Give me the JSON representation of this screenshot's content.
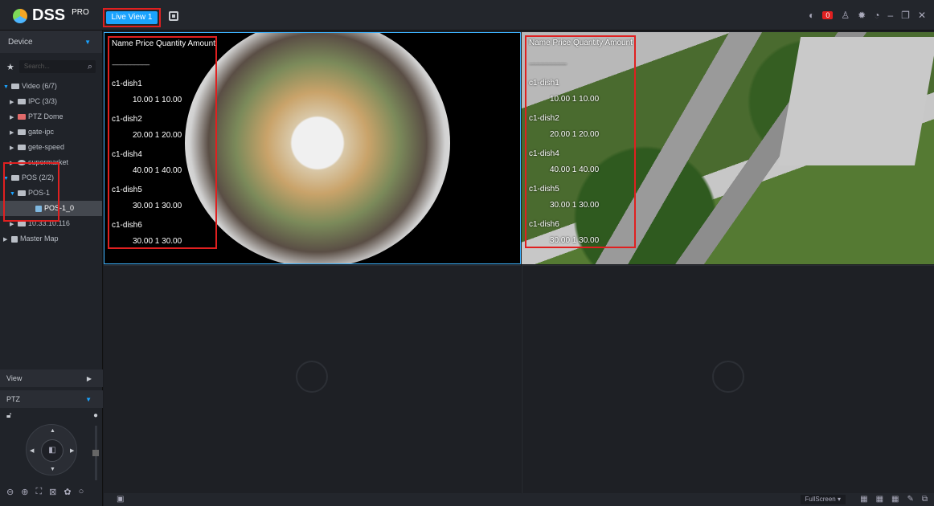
{
  "app": {
    "brand": "DSS",
    "edition": "PRO",
    "accent": "#1aa3ff",
    "alert_color": "#e02020"
  },
  "tabs": [
    {
      "label": "Live View 1"
    }
  ],
  "top_right": {
    "alarm_count": "0",
    "icons": [
      "speaker-icon",
      "user-icon",
      "gear-icon",
      "dashboard-icon",
      "minimize-icon",
      "restore-icon",
      "close-icon"
    ]
  },
  "sidebar": {
    "device_label": "Device",
    "search_placeholder": "Search...",
    "tree": [
      {
        "label": "Video (6/7)",
        "level": 0,
        "icon": "camera-group-icon"
      },
      {
        "label": "IPC (3/3)",
        "level": 1,
        "icon": "ipc-icon"
      },
      {
        "label": "PTZ Dome",
        "level": 1,
        "icon": "ptz-icon"
      },
      {
        "label": "gate-ipc",
        "level": 1,
        "icon": "device-icon"
      },
      {
        "label": "gete-speed",
        "level": 1,
        "icon": "device-icon"
      },
      {
        "label": "supermarket",
        "level": 1,
        "icon": "store-icon"
      },
      {
        "label": "POS (2/2)",
        "level": 0,
        "icon": "pos-group-icon"
      },
      {
        "label": "POS-1",
        "level": 1,
        "icon": "device-icon"
      },
      {
        "label": "POS-1_0",
        "level": 2,
        "icon": "pos-channel-icon"
      },
      {
        "label": "10.33.10.116",
        "level": 1,
        "icon": "device-icon"
      },
      {
        "label": "Master Map",
        "level": 0,
        "icon": "map-icon"
      }
    ],
    "view_label": "View",
    "ptz_label": "PTZ"
  },
  "pos_overlay": {
    "header": "Name   Price Quantity Amount",
    "separator": "----------------------------",
    "items": [
      {
        "name": "c1-dish1",
        "values": "10.00   1  10.00"
      },
      {
        "name": "c1-dish2",
        "values": "20.00   1  20.00"
      },
      {
        "name": "c1-dish4",
        "values": "40.00   1  40.00"
      },
      {
        "name": "c1-dish5",
        "values": "30.00   1  30.00"
      },
      {
        "name": "c1-dish6",
        "values": "30.00   1  30.00"
      }
    ]
  },
  "bottom": {
    "fullscreen_label": "FullScreen"
  }
}
